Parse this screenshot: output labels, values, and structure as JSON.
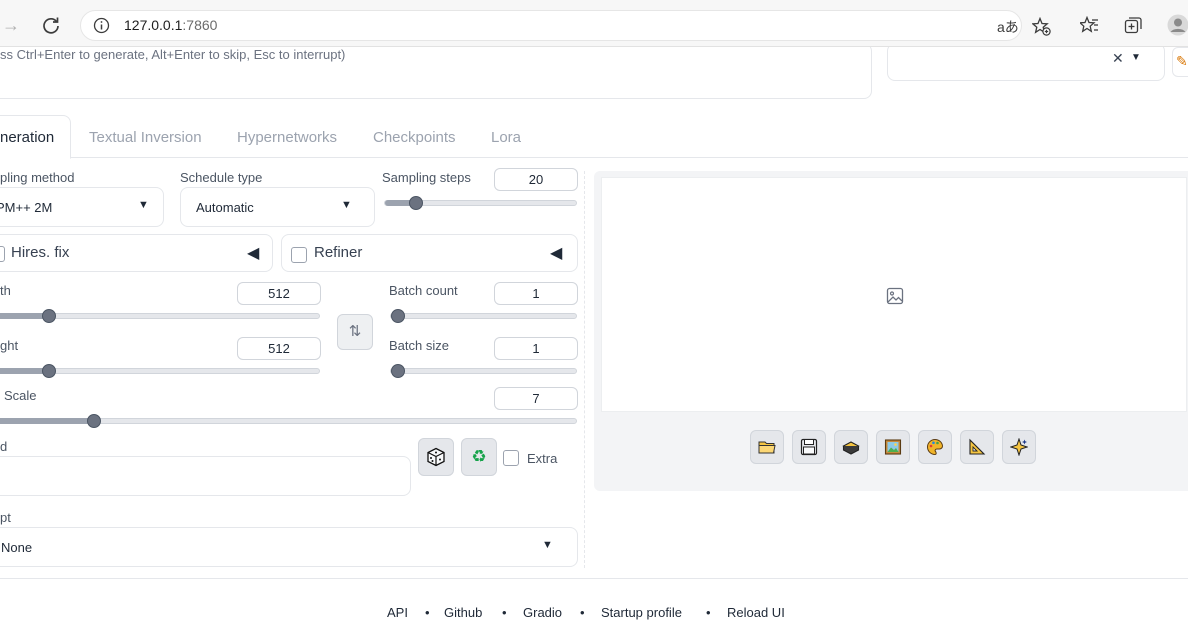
{
  "browser": {
    "url_host": "127.0.0.1",
    "url_port": ":7860",
    "back_icon": "arrow-right-icon",
    "reload_icon": "reload-icon",
    "info_icon": "info-icon"
  },
  "prompt": {
    "placeholder": "ss Ctrl+Enter to generate, Alt+Enter to skip, Esc to interrupt)"
  },
  "tabs": [
    "neration",
    "Textual Inversion",
    "Hypernetworks",
    "Checkpoints",
    "Lora"
  ],
  "sampling": {
    "method_label": "pling method",
    "method_value": "PM++ 2M",
    "schedule_label": "Schedule type",
    "schedule_value": "Automatic",
    "steps_label": "Sampling steps",
    "steps_value": "20",
    "steps_fraction": 0.16
  },
  "accordions": {
    "hires": "Hires. fix",
    "refiner": "Refiner"
  },
  "size": {
    "width_label": "th",
    "width_value": "512",
    "width_fraction": 0.2,
    "height_label": "ght",
    "height_value": "512",
    "height_fraction": 0.2,
    "batch_count_label": "Batch count",
    "batch_count_value": "1",
    "batch_size_label": "Batch size",
    "batch_size_value": "1"
  },
  "cfg": {
    "label": "Scale",
    "value": "7",
    "fraction": 0.19
  },
  "seed": {
    "label": "d",
    "extra_label": "Extra"
  },
  "script": {
    "label": "pt",
    "value": "None"
  },
  "footer": {
    "links": [
      "API",
      "Github",
      "Gradio",
      "Startup profile",
      "Reload UI"
    ],
    "separator": "•"
  },
  "toolbar": {
    "buttons": [
      "folder-icon",
      "save-icon",
      "zip-icon",
      "image-icon",
      "palette-icon",
      "ruler-icon",
      "sparkle-icon"
    ]
  },
  "colors": {
    "accent": "#6b7280",
    "border": "#e5e7eb"
  }
}
